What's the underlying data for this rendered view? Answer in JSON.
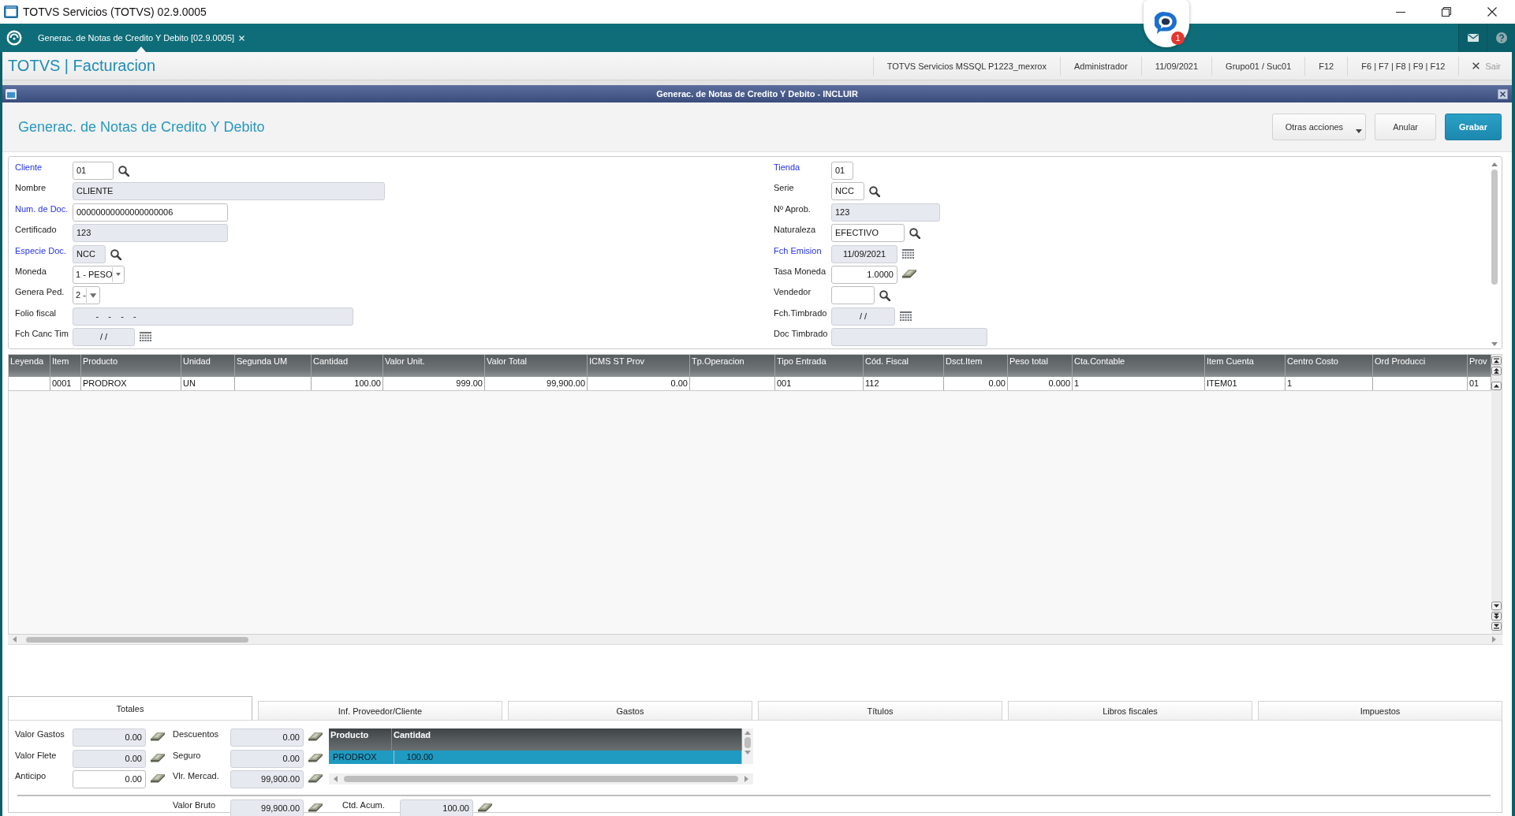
{
  "window": {
    "title": "TOTVS Servicios (TOTVS) 02.9.0005"
  },
  "app_tabs": [
    {
      "label": "Generac. de Notas de Credito Y Debito [02.9.0005]",
      "selected": true
    }
  ],
  "chat": {
    "badge": "1"
  },
  "header": {
    "brand": "TOTVS | Facturacion",
    "info": [
      "TOTVS Servicios MSSQL P1223_mexrox",
      "Administrador",
      "11/09/2021",
      "Grupo01 / Suc01",
      "F12",
      "F6 | F7 | F8 | F9 | F12"
    ],
    "exit": "Sair"
  },
  "dialog": {
    "title": "Generac. de Notas de Credito Y Debito - INCLUIR",
    "heading": "Generac. de Notas de Credito Y Debito",
    "actions": [
      {
        "label": "Otras acciones",
        "kind": "menu"
      },
      {
        "label": "Anular",
        "kind": "default"
      },
      {
        "label": "Grabar",
        "kind": "primary"
      }
    ]
  },
  "form": {
    "left": [
      {
        "label": "Cliente",
        "required": true,
        "value": "01",
        "kind": "lookup",
        "disabled": false
      },
      {
        "label": "Nombre",
        "required": false,
        "value": "CLIENTE",
        "kind": "text",
        "disabled": true
      },
      {
        "label": "Num. de Doc.",
        "required": true,
        "value": "00000000000000000006",
        "kind": "text",
        "disabled": false
      },
      {
        "label": "Certificado",
        "required": false,
        "value": "123",
        "kind": "text",
        "disabled": true
      },
      {
        "label": "Especie Doc.",
        "required": true,
        "value": "NCC",
        "kind": "lookup",
        "disabled": true
      },
      {
        "label": "Moneda",
        "required": false,
        "value": "1 - PESO",
        "kind": "select",
        "disabled": false
      },
      {
        "label": "Genera Ped.",
        "required": false,
        "value": "2 -",
        "kind": "select",
        "disabled": false
      },
      {
        "label": "Folio fiscal",
        "required": false,
        "value": "        -    -    -    -",
        "kind": "text",
        "disabled": true
      },
      {
        "label": "Fch Canc Tim",
        "required": false,
        "value": "/ /",
        "kind": "date",
        "disabled": true
      }
    ],
    "right": [
      {
        "label": "Tienda",
        "required": true,
        "value": "01",
        "kind": "text",
        "disabled": false
      },
      {
        "label": "Serie",
        "required": false,
        "value": "NCC",
        "kind": "lookup",
        "disabled": false
      },
      {
        "label": "Nº Aprob.",
        "required": false,
        "value": "123",
        "kind": "text",
        "disabled": true
      },
      {
        "label": "Naturaleza",
        "required": false,
        "value": "EFECTIVO",
        "kind": "lookup",
        "disabled": false
      },
      {
        "label": "Fch Emision",
        "required": true,
        "value": "11/09/2021",
        "kind": "date",
        "disabled": true
      },
      {
        "label": "Tasa Moneda",
        "required": false,
        "value": "1.0000",
        "kind": "money",
        "disabled": false
      },
      {
        "label": "Vendedor",
        "required": false,
        "kind": "lookup",
        "disabled": false
      },
      {
        "label": "Fch.Timbrado",
        "required": false,
        "value": "/ /",
        "kind": "date",
        "disabled": true
      },
      {
        "label": "Doc Timbrado",
        "required": false,
        "kind": "text",
        "disabled": true
      }
    ]
  },
  "grid": {
    "columns": [
      {
        "label": "Leyenda",
        "kind": "text"
      },
      {
        "label": "Item",
        "kind": "text"
      },
      {
        "label": "Producto",
        "kind": "text"
      },
      {
        "label": "Unidad",
        "kind": "text"
      },
      {
        "label": "Segunda UM",
        "kind": "text"
      },
      {
        "label": "Cantidad",
        "kind": "number"
      },
      {
        "label": "Valor Unit.",
        "kind": "number"
      },
      {
        "label": "Valor Total",
        "kind": "number"
      },
      {
        "label": "ICMS ST Prov",
        "kind": "number"
      },
      {
        "label": "Tp.Operacion",
        "kind": "text"
      },
      {
        "label": "Tipo Entrada",
        "kind": "text"
      },
      {
        "label": "Cód. Fiscal",
        "kind": "text"
      },
      {
        "label": "Dsct.Item",
        "kind": "number"
      },
      {
        "label": "Peso total",
        "kind": "number"
      },
      {
        "label": "Cta.Contable",
        "kind": "text"
      },
      {
        "label": "Item Cuenta",
        "kind": "text"
      },
      {
        "label": "Centro Costo",
        "kind": "text"
      },
      {
        "label": "Ord Producci",
        "kind": "text"
      },
      {
        "label": "Prov",
        "kind": "text"
      }
    ],
    "rows": [
      [
        null,
        "0001",
        "PRODROX",
        "UN",
        null,
        "100.00",
        "999.00",
        "99,900.00",
        "0.00",
        null,
        "001",
        "112",
        "0.00",
        "0.000",
        "1",
        "ITEM01",
        "1",
        null,
        "01"
      ]
    ]
  },
  "folder_tabs": [
    {
      "label": "Totales",
      "selected": true
    },
    {
      "label": "Inf. Proveedor/Cliente",
      "selected": false
    },
    {
      "label": "Gastos",
      "selected": false
    },
    {
      "label": "Títulos",
      "selected": false
    },
    {
      "label": "Libros fiscales",
      "selected": false
    },
    {
      "label": "Impuestos",
      "selected": false
    }
  ],
  "totals": {
    "columns": [
      [
        {
          "label": "Valor Gastos",
          "value": "0.00",
          "disabled": true
        },
        {
          "label": "Valor Flete",
          "value": "0.00",
          "disabled": true
        },
        {
          "label": "Anticipo",
          "value": "0.00",
          "disabled": false
        }
      ],
      [
        {
          "label": "Descuentos",
          "value": "0.00",
          "disabled": true
        },
        {
          "label": "Seguro",
          "value": "0.00",
          "disabled": true
        },
        {
          "label": "Vlr. Mercad.",
          "value": "99,900.00",
          "disabled": true
        }
      ]
    ],
    "items_grid": {
      "columns": [
        "Producto",
        "Cantidad"
      ],
      "rows": [
        {
          "cells": [
            "PRODROX",
            "100.00"
          ],
          "selected": true
        }
      ]
    },
    "footer": [
      {
        "label": "Valor Bruto",
        "value": "99,900.00",
        "disabled": true
      },
      {
        "label": "Ctd. Acum.",
        "value": "100.00",
        "disabled": true
      }
    ]
  }
}
